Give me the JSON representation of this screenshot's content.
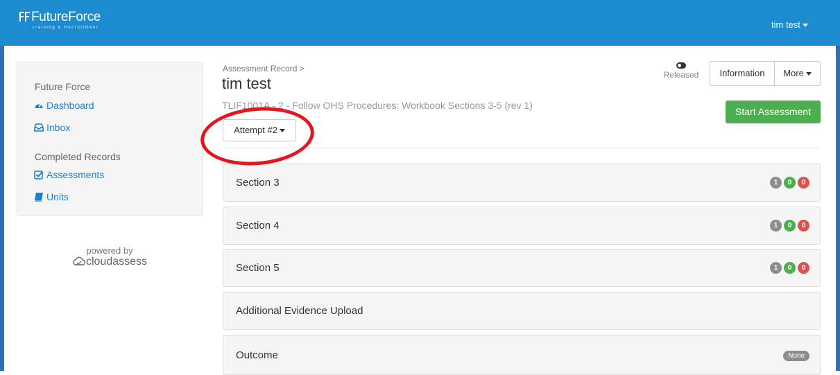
{
  "header": {
    "logo_text": "FutureForce",
    "logo_tagline": "Training & Recruitment",
    "user_menu": "tim test"
  },
  "sidebar": {
    "org_heading": "Future Force",
    "nav": [
      {
        "label": "Dashboard",
        "icon": "tachometer-icon"
      },
      {
        "label": "Inbox",
        "icon": "inbox-icon"
      }
    ],
    "records_heading": "Completed Records",
    "records": [
      {
        "label": "Assessments",
        "icon": "check-square-icon"
      },
      {
        "label": "Units",
        "icon": "book-icon"
      }
    ]
  },
  "footer": {
    "powered_by": "powered by",
    "brand": "cloudassess"
  },
  "page": {
    "breadcrumb": "Assessment Record",
    "breadcrumb_separator": ">",
    "title": "tim test",
    "subtitle": "TLIF1001A - 2 - Follow OHS Procedures: Workbook Sections 3-5 (rev 1)",
    "attempt_label": "Attempt #2",
    "released_label": "Released"
  },
  "actions": {
    "information": "Information",
    "more": "More",
    "start_assessment": "Start Assessment"
  },
  "sections": [
    {
      "title": "Section 3",
      "counts": [
        "1",
        "0",
        "0"
      ]
    },
    {
      "title": "Section 4",
      "counts": [
        "1",
        "0",
        "0"
      ]
    },
    {
      "title": "Section 5",
      "counts": [
        "1",
        "0",
        "0"
      ]
    },
    {
      "title": "Additional Evidence Upload",
      "counts": []
    },
    {
      "title": "Outcome",
      "status": "None"
    }
  ],
  "colors": {
    "navbar": "#1d8bd0",
    "link": "#1f7fc4",
    "success": "#4cae4f",
    "badge_grey": "#8d8d8d",
    "badge_green": "#4cae4f",
    "badge_red": "#d9534f",
    "annotation": "#e8131b"
  }
}
